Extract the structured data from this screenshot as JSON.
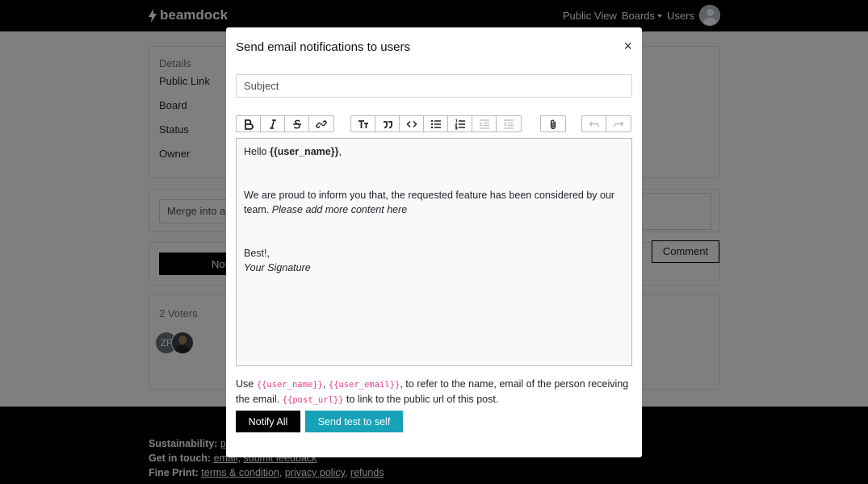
{
  "navbar": {
    "brand": "beamdock",
    "public_view": "Public View",
    "boards": "Boards",
    "users": "Users"
  },
  "details": {
    "header": "Details",
    "rows": [
      "Public Link",
      "Board",
      "Status",
      "Owner"
    ]
  },
  "merge": {
    "placeholder": "Merge into an"
  },
  "notify_bg": {
    "label": "Not"
  },
  "comment": {
    "label": "Comment"
  },
  "voters": {
    "header": "2 Voters",
    "initials": "ZF"
  },
  "footer": {
    "sustainability_label": "Sustainability:",
    "sustainability_link": "pr",
    "getintouch_label": "Get in touch:",
    "email_link": "email",
    "feedback_link": "submit feedback",
    "fineprint_label": "Fine Print:",
    "terms_link": "terms & condition",
    "privacy_link": "privacy policy",
    "refunds_link": "refunds"
  },
  "modal": {
    "title": "Send email notifications to users",
    "close": "×",
    "subject_placeholder": "Subject",
    "toolbar_icons": [
      "bold-icon",
      "italic-icon",
      "strikethrough-icon",
      "link-icon",
      "heading-icon",
      "quote-icon",
      "code-icon",
      "bullet-list-icon",
      "numbered-list-icon",
      "outdent-icon",
      "indent-icon",
      "attach-icon",
      "undo-icon",
      "redo-icon"
    ],
    "editor": {
      "greeting_prefix": "Hello ",
      "greeting_var": "{{user_name}}",
      "greeting_suffix": ",",
      "body_text": "We are proud to inform you that, the requested feature has been considered by our team. ",
      "body_italic": "Please add more content here",
      "signoff": "Best!,",
      "signature": "Your Signature"
    },
    "hint": {
      "use": "Use ",
      "var_name": "{{user_name}}",
      "comma1": ", ",
      "var_email": "{{user_email}}",
      "text1": ",  to refer to the name, email of the person receiving the email. ",
      "var_url": "{{post_url}}",
      "text2": "  to link to the public url of this post."
    },
    "notify_all": "Notify All",
    "send_test": "Send test to self"
  },
  "colors": {
    "accent": "#17a2b8",
    "code": "#e83e8c",
    "primary": "#000000"
  }
}
